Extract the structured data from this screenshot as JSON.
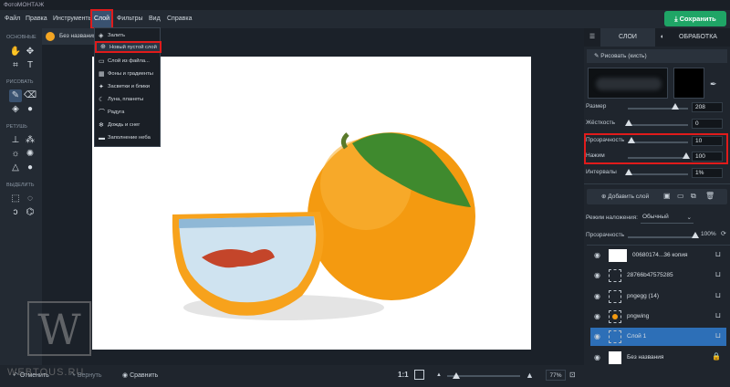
{
  "app": {
    "title": "ФотоМОНТАЖ"
  },
  "menu": {
    "items": [
      "Файл",
      "Правка",
      "Инструменты",
      "Слой",
      "Фильтры",
      "Вид",
      "Справка"
    ],
    "save": "Сохранить"
  },
  "tools": {
    "sections": [
      "ОСНОВНЫЕ",
      "РИСОВАТЬ",
      "РЕТУШЬ",
      "ВЫДЕЛИТЬ"
    ]
  },
  "doc": {
    "tab": "Без названия"
  },
  "dropdown": {
    "items": [
      "Залить",
      "Новый пустой слой",
      "Слой из файла...",
      "Фоны и градиенты",
      "Засветки и блики",
      "Луна, планеты",
      "Радуга",
      "Дождь и снег",
      "Заполнение неба"
    ]
  },
  "panel": {
    "tabs": [
      "СЛОИ",
      "ОБРАБОТКА"
    ],
    "brush": "Рисовать (кисть)",
    "sliders": [
      {
        "label": "Размер",
        "value": "208"
      },
      {
        "label": "Жёсткость",
        "value": "0"
      },
      {
        "label": "Прозрачность",
        "value": "10"
      },
      {
        "label": "Нажим",
        "value": "100"
      },
      {
        "label": "Интервалы",
        "value": "1%"
      }
    ],
    "add_layer": "Добавить слой",
    "blend_label": "Режим наложения:",
    "blend_value": "Обычный",
    "opacity_label": "Прозрачность",
    "opacity_value": "100%",
    "layers": [
      "00680174...36 копия",
      "28766b47575285",
      "pngegg (14)",
      "pngwing",
      "Слой 1",
      "Без названия"
    ]
  },
  "bottom": {
    "undo": "Отменить",
    "redo": "Вернуть",
    "compare": "Сравнить",
    "ratio": "1:1",
    "zoom": "77%"
  },
  "watermark": "WEBTOUS.RU",
  "colors": {
    "accent": "#1fa566",
    "highlight": "#e01b1b",
    "selected": "#2d6fb7"
  }
}
